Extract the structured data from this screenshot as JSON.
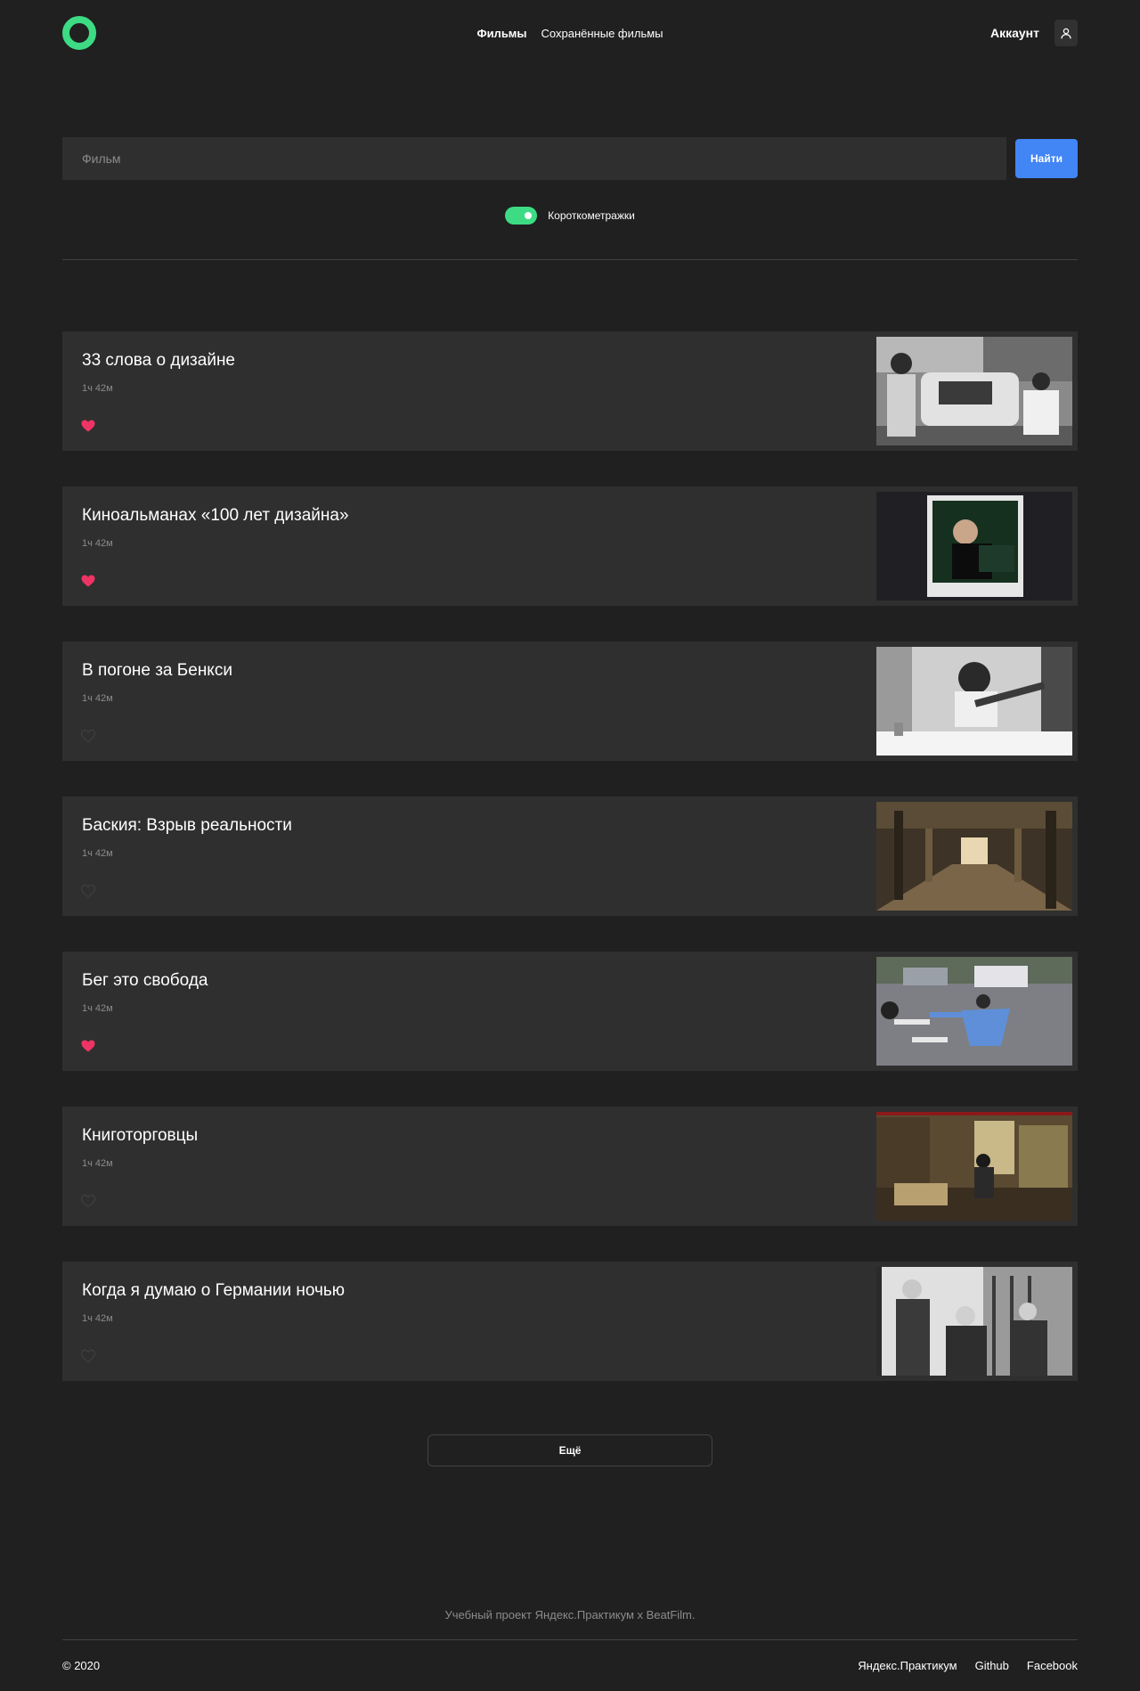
{
  "header": {
    "logo_alt": "",
    "nav": [
      {
        "label": "Фильмы",
        "active": true
      },
      {
        "label": "Сохранённые фильмы",
        "active": false
      }
    ],
    "account_label": "Аккаунт"
  },
  "search": {
    "placeholder": "Фильм",
    "value": "",
    "button_label": "Найти",
    "shorts_label": "Короткометражки",
    "shorts_enabled": true
  },
  "movies": [
    {
      "title": "33 слова о дизайне",
      "duration": "1ч 42м",
      "liked": true,
      "thumb": "street-scene-photo"
    },
    {
      "title": "Киноальманах «100 лет дизайна»",
      "duration": "1ч 42м",
      "liked": true,
      "thumb": "polaroid-portrait-photo"
    },
    {
      "title": "В погоне за Бенкси",
      "duration": "1ч 42м",
      "liked": false,
      "thumb": "guitarist-photo"
    },
    {
      "title": "Баския: Взрыв реальности",
      "duration": "1ч 42м",
      "liked": false,
      "thumb": "empty-hall-photo"
    },
    {
      "title": "Бег это свобода",
      "duration": "1ч 42м",
      "liked": true,
      "thumb": "street-crossing-photo"
    },
    {
      "title": "Книготорговцы",
      "duration": "1ч 42м",
      "liked": false,
      "thumb": "bookstore-interior-photo"
    },
    {
      "title": "Когда я думаю о Германии ночью",
      "duration": "1ч 42м",
      "liked": false,
      "thumb": "three-men-photo"
    }
  ],
  "more_label": "Ещё",
  "footer": {
    "note": "Учебный проект Яндекс.Практикум х BeatFilm.",
    "copyright": "© 2020",
    "links": [
      "Яндекс.Практикум",
      "Github",
      "Facebook"
    ]
  },
  "colors": {
    "background": "#202020",
    "card": "#2f2f2f",
    "accent_green": "#3ddc84",
    "button_blue": "#4285f4",
    "like_active": "#ee3465",
    "muted_text": "#8b8b8b"
  }
}
